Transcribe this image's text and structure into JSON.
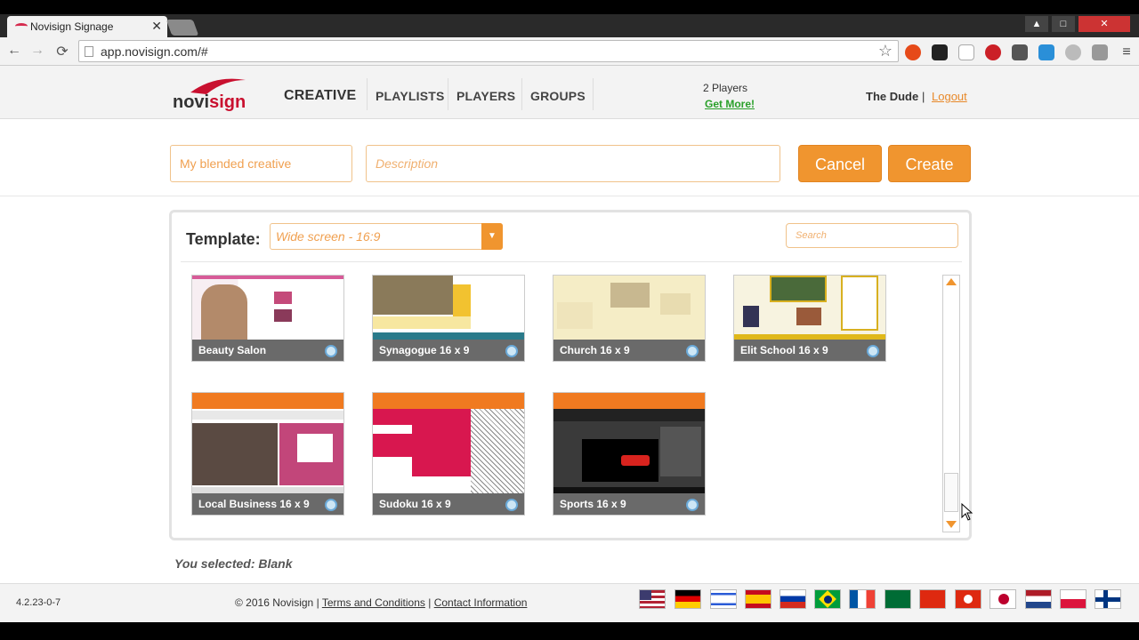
{
  "browser": {
    "tab_title": "Novisign Signage",
    "tab_close": "✕",
    "url": "app.novisign.com/#",
    "back": "←",
    "forward": "→",
    "reload": "⟳",
    "bookmark_star": "☆",
    "window_controls": [
      "▲",
      "□",
      "✕"
    ]
  },
  "header": {
    "logo_text_a": "novi",
    "logo_text_b": "sign",
    "nav": [
      "CREATIVE",
      "PLAYLISTS",
      "PLAYERS",
      "GROUPS"
    ],
    "players_count": "2 Players",
    "get_more": "Get More!",
    "user": "The Dude",
    "separator": "|",
    "logout": "Logout"
  },
  "form": {
    "name_value": "My blended creative",
    "description_placeholder": "Description",
    "cancel": "Cancel",
    "create": "Create"
  },
  "template_panel": {
    "label": "Template:",
    "selected_format": "Wide screen - 16:9",
    "search_placeholder": "Search",
    "cards": [
      {
        "name": "Beauty Salon"
      },
      {
        "name": "Synagogue 16 x 9"
      },
      {
        "name": "Church 16 x 9"
      },
      {
        "name": "Elit School 16 x 9"
      },
      {
        "name": "Local Business 16 x 9"
      },
      {
        "name": "Sudoku 16 x 9"
      },
      {
        "name": "Sports 16 x 9"
      }
    ]
  },
  "selection": {
    "text": "You selected: Blank"
  },
  "footer": {
    "version": "4.2.23-0-7",
    "copyright": "© 2016 Novisign",
    "terms": "Terms and Conditions",
    "contact": "Contact Information",
    "separator": "|"
  }
}
